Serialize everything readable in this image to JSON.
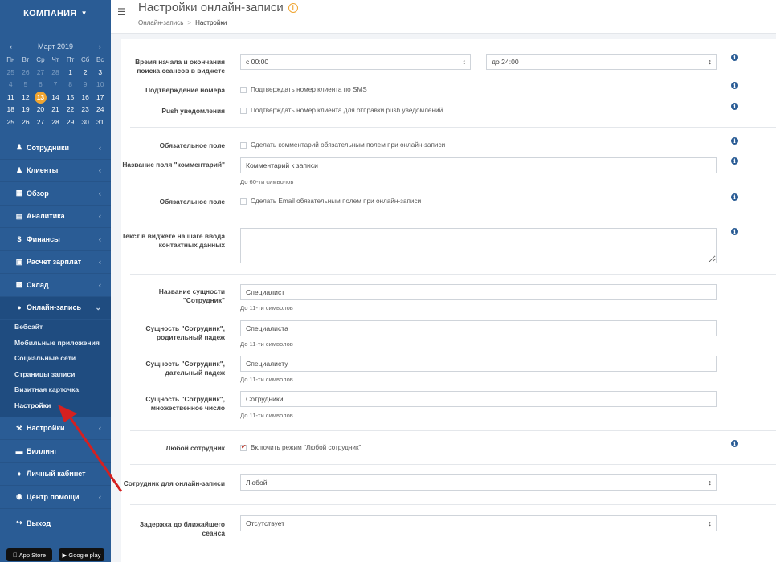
{
  "sidebar": {
    "company": "КОМПАНИЯ",
    "calendar": {
      "month": "Март 2019",
      "weekdays": [
        "Пн",
        "Вт",
        "Ср",
        "Чт",
        "Пт",
        "Сб",
        "Вс"
      ],
      "weeks": [
        [
          "25",
          "26",
          "27",
          "28",
          "1",
          "2",
          "3"
        ],
        [
          "4",
          "5",
          "6",
          "7",
          "8",
          "9",
          "10"
        ],
        [
          "11",
          "12",
          "13",
          "14",
          "15",
          "16",
          "17"
        ],
        [
          "18",
          "19",
          "20",
          "21",
          "22",
          "23",
          "24"
        ],
        [
          "25",
          "26",
          "27",
          "28",
          "29",
          "30",
          "31"
        ]
      ],
      "today": "13"
    },
    "menu": {
      "staff": "Сотрудники",
      "clients": "Клиенты",
      "overview": "Обзор",
      "analytics": "Аналитика",
      "finance": "Финансы",
      "salary": "Расчет зарплат",
      "warehouse": "Склад",
      "online": "Онлайн-запись",
      "settings": "Настройки",
      "billing": "Биллинг",
      "cabinet": "Личный кабинет",
      "help": "Центр помощи",
      "exit": "Выход"
    },
    "submenu": {
      "website": "Вебсайт",
      "mobile": "Мобильные приложения",
      "social": "Социальные сети",
      "pages": "Страницы записи",
      "card": "Визитная карточка",
      "settings": "Настройки"
    },
    "stores": {
      "appstore": "App Store",
      "googleplay": "Google play"
    }
  },
  "header": {
    "title": "Настройки онлайн-записи",
    "crumb1": "Онлайн-запись",
    "crumb_sep": ">",
    "crumb2": "Настройки"
  },
  "form": {
    "time_label": "Время начала и окончания поиска сеансов в виджете",
    "time_from": "с 00:00",
    "time_to": "до 24:00",
    "phone_label": "Подтверждение номера",
    "phone_chk": "Подтверждать номер клиента по SMS",
    "push_label": "Push уведомления",
    "push_chk": "Подтверждать номер клиента для отправки push уведомлений",
    "req1_label": "Обязательное поле",
    "req1_chk": "Сделать комментарий обязательным полем при онлайн-записи",
    "comment_label": "Название поля \"комментарий\"",
    "comment_value": "Комментарий к записи",
    "comment_hint": "До 60-ти символов",
    "req2_label": "Обязательное поле",
    "req2_chk": "Сделать Email обязательным полем при онлайн-записи",
    "text_label": "Текст в виджете на шаге ввода контактных данных",
    "entity_label": "Название сущности \"Сотрудник\"",
    "entity_value": "Специалист",
    "entity_hint": "До 11-ти символов",
    "gen_label": "Сущность \"Сотрудник\", родительный падеж",
    "gen_value": "Специалиста",
    "gen_hint": "До 11-ти символов",
    "dat_label": "Сущность \"Сотрудник\", дательный падеж",
    "dat_value": "Специалисту",
    "dat_hint": "До 11-ти символов",
    "plural_label": "Сущность \"Сотрудник\", множественное число",
    "plural_value": "Сотрудники",
    "plural_hint": "До 11-ти символов",
    "any_label": "Любой сотрудник",
    "any_chk": "Включить режим \"Любой сотрудник\"",
    "staff_label": "Сотрудник для онлайн-записи",
    "staff_value": "Любой",
    "delay_label": "Задержка до ближайшего сеанса",
    "delay_value": "Отсутствует"
  },
  "colors": {
    "sidebar": "#2a5c95",
    "accent": "#f0a531",
    "arrow": "#d42020"
  }
}
